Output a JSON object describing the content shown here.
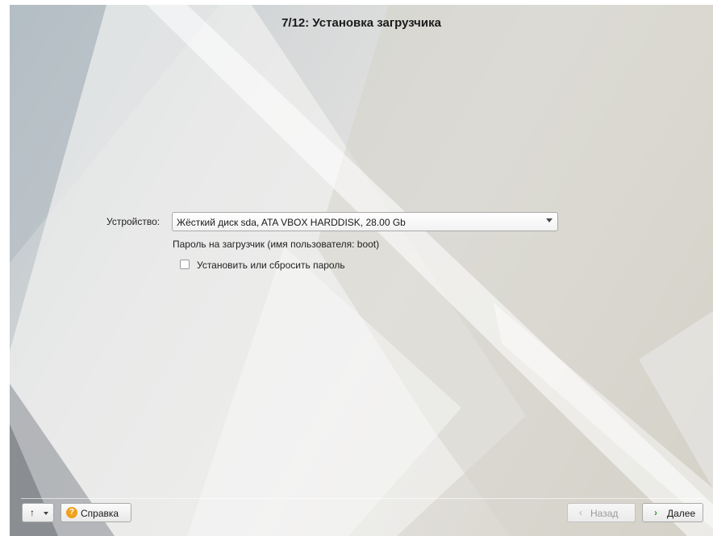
{
  "window": {
    "title": "7/12: Установка загрузчика"
  },
  "form": {
    "device_label": "Устройство:",
    "device_value": "Жёсткий диск sda, ATA VBOX HARDDISK, 28.00 Gb",
    "password_label": "Пароль на загрузчик (имя пользователя: boot)",
    "set_password_label": "Установить или сбросить пароль",
    "set_password_checked": false
  },
  "footer": {
    "up_glyph": "↑",
    "help_label": "Справка",
    "help_glyph": "?",
    "back_label": "Назад",
    "back_glyph": "‹",
    "next_label": "Далее",
    "next_glyph": "›"
  },
  "colors": {
    "help_icon": "#f0a21e",
    "next_chevron": "#2e9a2e"
  }
}
